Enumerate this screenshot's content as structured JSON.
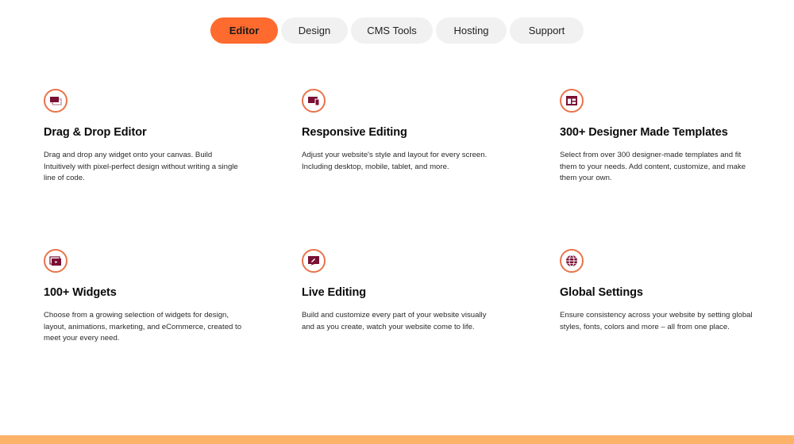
{
  "tabs": [
    {
      "label": "Editor",
      "active": true
    },
    {
      "label": "Design",
      "active": false
    },
    {
      "label": "CMS Tools",
      "active": false
    },
    {
      "label": "Hosting",
      "active": false
    },
    {
      "label": "Support",
      "active": false
    }
  ],
  "features": [
    {
      "icon": "drag-drop-icon",
      "title": "Drag & Drop Editor",
      "description": "Drag and drop any widget onto your canvas. Build Intuitively with pixel-perfect design without writing a single line of code."
    },
    {
      "icon": "responsive-icon",
      "title": "Responsive Editing",
      "description": "Adjust your website's style and layout for every screen. Including desktop, mobile, tablet, and more."
    },
    {
      "icon": "templates-icon",
      "title": "300+ Designer Made Templates",
      "description": "Select from over 300 designer-made templates and fit them to your needs. Add content, customize, and make them your own."
    },
    {
      "icon": "widgets-icon",
      "title": "100+ Widgets",
      "description": "Choose from a growing selection of widgets for design, layout, animations, marketing, and eCommerce, created to meet your every need."
    },
    {
      "icon": "live-editing-icon",
      "title": "Live Editing",
      "description": "Build and customize every part of your website visually and as you create, watch your website come to life."
    },
    {
      "icon": "globe-icon",
      "title": "Global Settings",
      "description": "Ensure consistency across your website by setting global styles, fonts, colors and more – all from one place."
    }
  ],
  "colors": {
    "accent": "#ff6a2e",
    "icon_fill": "#7a0f33",
    "icon_ring": "#e8744a",
    "tab_bg": "#f1f1f1",
    "bottom_bar": "#fbb36a"
  }
}
